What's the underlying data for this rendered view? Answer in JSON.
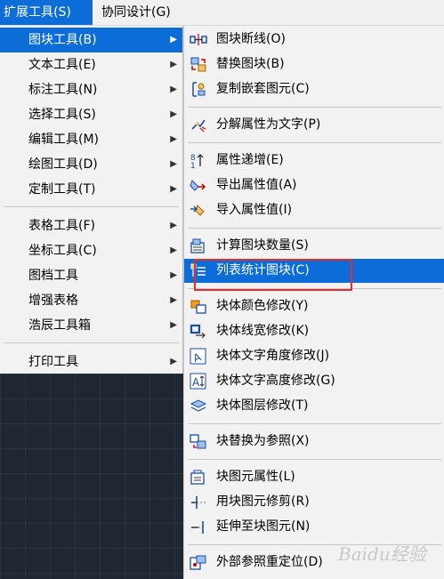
{
  "menubar": {
    "ext_label": "扩展工具(S)",
    "co_label": "协同设计(G)"
  },
  "menu1": {
    "items": [
      {
        "label": "图块工具(B)"
      },
      {
        "label": "文本工具(E)"
      },
      {
        "label": "标注工具(N)"
      },
      {
        "label": "选择工具(S)"
      },
      {
        "label": "编辑工具(M)"
      },
      {
        "label": "绘图工具(D)"
      },
      {
        "label": "定制工具(T)"
      },
      {
        "label": "表格工具(F)"
      },
      {
        "label": "坐标工具(C)"
      },
      {
        "label": "图档工具"
      },
      {
        "label": "增强表格"
      },
      {
        "label": "浩辰工具箱"
      },
      {
        "label": "打印工具"
      }
    ],
    "arrow": "▶"
  },
  "menu2": {
    "items": [
      {
        "label": "图块断线(O)",
        "icon": "block-break-icon"
      },
      {
        "label": "替换图块(B)",
        "icon": "replace-block-icon"
      },
      {
        "label": "复制嵌套图元(C)",
        "icon": "copy-nested-icon"
      },
      {
        "label": "分解属性为文字(P)",
        "icon": "explode-attr-icon"
      },
      {
        "label": "属性递增(E)",
        "icon": "attr-increment-icon"
      },
      {
        "label": "导出属性值(A)",
        "icon": "export-attr-icon"
      },
      {
        "label": "导入属性值(I)",
        "icon": "import-attr-icon"
      },
      {
        "label": "计算图块数量(S)",
        "icon": "count-blocks-icon"
      },
      {
        "label": "列表统计图块(C)",
        "icon": "list-blocks-icon"
      },
      {
        "label": "块体颜色修改(Y)",
        "icon": "block-color-icon"
      },
      {
        "label": "块体线宽修改(K)",
        "icon": "block-linewidth-icon"
      },
      {
        "label": "块体文字角度修改(J)",
        "icon": "text-angle-icon"
      },
      {
        "label": "块体文字高度修改(G)",
        "icon": "text-height-icon"
      },
      {
        "label": "块体图层修改(T)",
        "icon": "block-layer-icon"
      },
      {
        "label": "块替换为参照(X)",
        "icon": "block-to-xref-icon"
      },
      {
        "label": "块图元属性(L)",
        "icon": "block-entity-attr-icon"
      },
      {
        "label": "用块图元修剪(R)",
        "icon": "trim-with-block-icon"
      },
      {
        "label": "延伸至块图元(N)",
        "icon": "extend-to-block-icon"
      },
      {
        "label": "外部参照重定位(D)",
        "icon": "xref-relocate-icon"
      }
    ]
  },
  "colors": {
    "selection": "#0c6cd8",
    "highlight_box": "#e0302e"
  },
  "watermark": "Baidu经验"
}
